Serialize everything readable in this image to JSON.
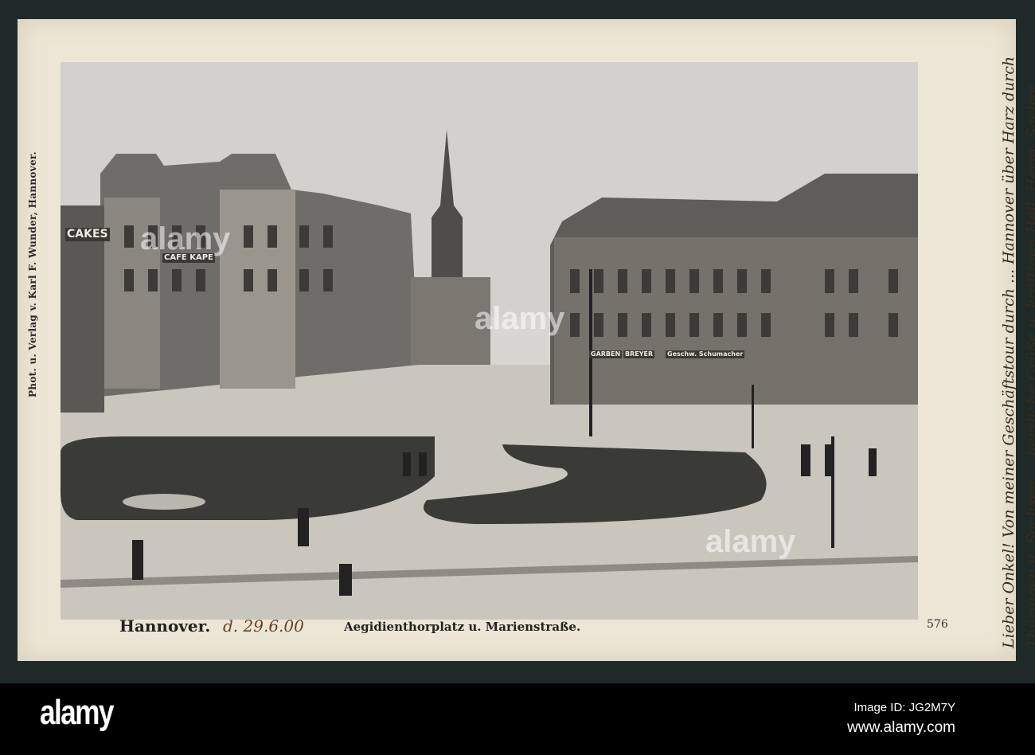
{
  "postcard": {
    "publisher_line": "Phot. u. Verlag v. Karl F. Wunder, Hannover.",
    "city": "Hannover.",
    "handwritten_date": "d. 29.6.00",
    "place": "Aegidienthorplatz u. Marienstraße.",
    "card_number": "576",
    "handwritten_message": "Lieber Onkel! Von meiner Geschäftstour durch ... Hannover über Harz durch Thüringen u. Sachsen ... herzliche Grüße u. kräftigen Heil. Herm. Sachse",
    "signs": [
      "CAKES",
      "CAFE KAPE",
      "GARBEN",
      "BREYER",
      "Geschw. Schumacher"
    ]
  },
  "footer": {
    "logo": "alamy",
    "image_id": "Image ID: JG2M7Y",
    "website": "www.alamy.com"
  },
  "colors": {
    "card": "#ece6d6",
    "frame": "#1f2a28",
    "footer": "#000000"
  }
}
